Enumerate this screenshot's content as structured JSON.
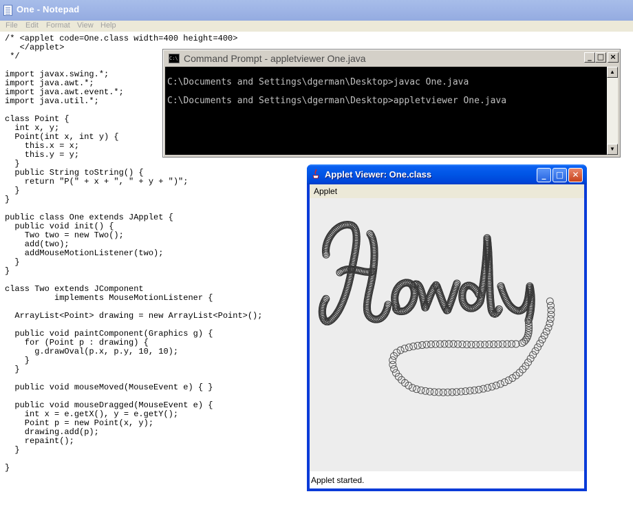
{
  "notepad": {
    "title": "One - Notepad",
    "menu": [
      "File",
      "Edit",
      "Format",
      "View",
      "Help"
    ],
    "code": "/* <applet code=One.class width=400 height=400>\n   </applet>\n */\n\nimport javax.swing.*;\nimport java.awt.*;\nimport java.awt.event.*;\nimport java.util.*;\n\nclass Point {\n  int x, y;\n  Point(int x, int y) {\n    this.x = x;\n    this.y = y;\n  }\n  public String toString() {\n    return \"P(\" + x + \", \" + y + \")\";\n  }\n}\n\npublic class One extends JApplet {\n  public void init() {\n    Two two = new Two();\n    add(two);\n    addMouseMotionListener(two);\n  }\n}\n\nclass Two extends JComponent\n          implements MouseMotionListener {\n\n  ArrayList<Point> drawing = new ArrayList<Point>();\n\n  public void paintComponent(Graphics g) {\n    for (Point p : drawing) {\n      g.drawOval(p.x, p.y, 10, 10);\n    }\n  }\n\n  public void mouseMoved(MouseEvent e) { }\n\n  public void mouseDragged(MouseEvent e) {\n    int x = e.getX(), y = e.getY();\n    Point p = new Point(x, y);\n    drawing.add(p);\n    repaint();\n  }\n\n}"
  },
  "cmd": {
    "title": "Command Prompt - appletviewer One.java",
    "lines": [
      "C:\\Documents and Settings\\dgerman\\Desktop>javac One.java",
      "C:\\Documents and Settings\\dgerman\\Desktop>appletviewer One.java"
    ]
  },
  "applet": {
    "title": "Applet Viewer: One.class",
    "menu": "Applet",
    "status": "Applet started.",
    "drawing_colors": {
      "bold": "#383838",
      "light": "#4a4a4a"
    }
  },
  "colors": {
    "xp_blue": "#0055e5",
    "close_red": "#c7421b",
    "notepad_titlebar": "#9fb5e6",
    "console_bg": "#000000",
    "console_text": "#c0c0c0"
  }
}
